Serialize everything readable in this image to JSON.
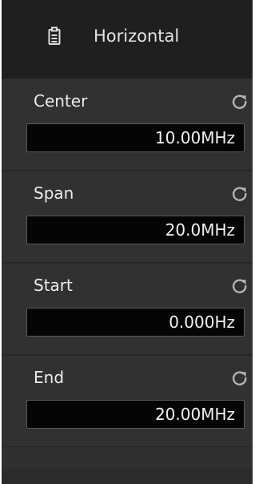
{
  "header": {
    "title": "Horizontal",
    "icon": "memo-icon"
  },
  "fields": [
    {
      "label": "Center",
      "value": "10.00MHz",
      "reset_icon": "reset-icon"
    },
    {
      "label": "Span",
      "value": "20.0MHz",
      "reset_icon": "reset-icon"
    },
    {
      "label": "Start",
      "value": "0.000Hz",
      "reset_icon": "reset-icon"
    },
    {
      "label": "End",
      "value": "20.00MHz",
      "reset_icon": "reset-icon"
    }
  ],
  "colors": {
    "panel_background": "#303030",
    "header_background": "#1f1f1f",
    "field_background": "#050505",
    "text": "#ececec"
  }
}
